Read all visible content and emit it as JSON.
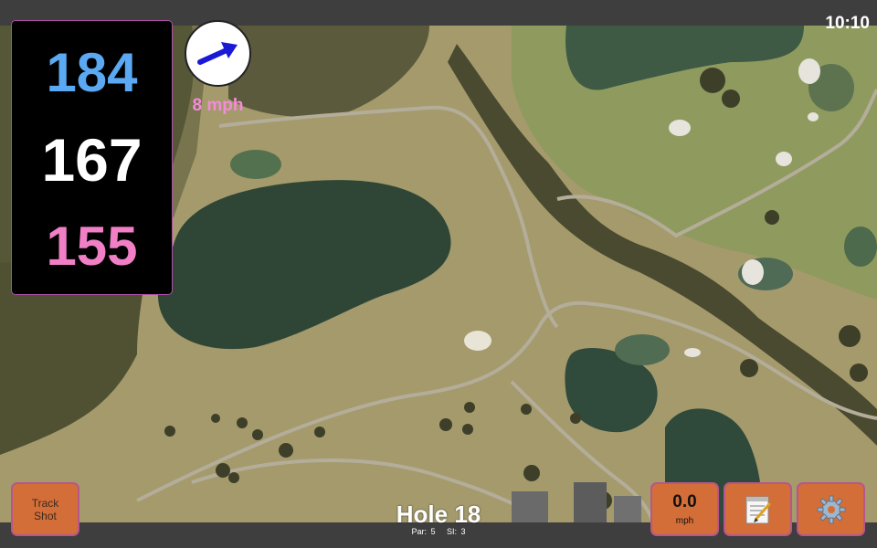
{
  "status": {
    "time": "10:10"
  },
  "distances": {
    "back": "184",
    "middle": "167",
    "front": "155"
  },
  "colors": {
    "back": "#5aa9f2",
    "middle": "#ffffff",
    "front": "#f07fc6",
    "button": "#d46e38",
    "wind_arrow": "#1a1ad6"
  },
  "wind": {
    "speed_label": "8 mph",
    "icon": "wind-direction-arrow-icon"
  },
  "buttons": {
    "track_shot_line1": "Track",
    "track_shot_line2": "Shot",
    "speed_value": "0.0",
    "speed_unit": "mph",
    "notes_icon": "notepad-icon",
    "settings_icon": "gear-icon"
  },
  "hole": {
    "title": "Hole 18",
    "par": "Par: 5",
    "si": "SI: 3"
  }
}
